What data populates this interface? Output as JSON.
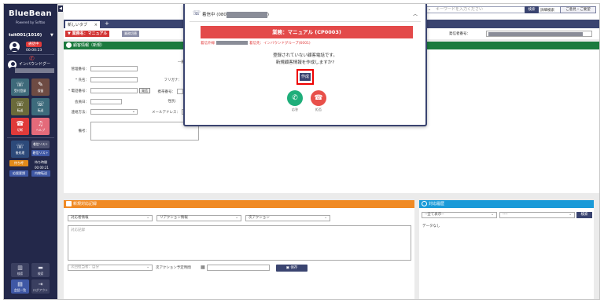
{
  "app": {
    "logo": "BlueBean",
    "logo_sub": "Powered by Softbo"
  },
  "sidebar": {
    "user_id": "tsit001(1010)",
    "status": "通話中",
    "status_time": "00:00:23",
    "group": "インバウンドグー",
    "tiles_row1": [
      {
        "label": "受付登録",
        "icon": "☏"
      },
      {
        "label": "保留",
        "icon": "✎"
      }
    ],
    "tiles_row2": [
      {
        "label": "転送",
        "icon": "☏"
      },
      {
        "label": "転送",
        "icon": "☏"
      }
    ],
    "tiles_row3": [
      {
        "label": "切断",
        "icon": "☎"
      },
      {
        "label": "ヘルプ",
        "icon": "♫"
      }
    ],
    "tiles_row4": [
      {
        "label": "後処理",
        "icon": "☏"
      },
      {
        "label": "着信リスト",
        "icon": "☰"
      }
    ],
    "call_list_btn": "着信リスト",
    "waiting_btn": "待ち呼",
    "waiting_count_label": "待ち時間",
    "waiting_time": "00:00:21",
    "btn_a": "応援要請",
    "btn_b": "内線転送",
    "bottom_tiles": [
      {
        "label": "検索",
        "icon": "▥"
      },
      {
        "label": "検索",
        "icon": "▬"
      }
    ],
    "bottom_tiles2": [
      {
        "label": "会話一覧",
        "icon": "▤"
      },
      {
        "label": "ログアウト",
        "icon": "⇥"
      }
    ]
  },
  "topbar": {
    "search_placeholder": "キーワードを入力ください",
    "search_btn": "検索",
    "detail_search": "詳細検索",
    "manage_label": "ご意見・ご要望"
  },
  "tabs": [
    {
      "label": "新しいタブ"
    }
  ],
  "tab_add": "+",
  "tab_close": "×",
  "workrow": {
    "business_label": "▼ 業務名：マニュアル",
    "business_change": "業務切替",
    "caller_label": "発信者番号："
  },
  "customer": {
    "header": "顧客情報（新規）",
    "fields": {
      "manage_no": "管理番号：",
      "name": "* 氏名：",
      "furigana": "フリガナ：",
      "phone": "* 電話番号：",
      "mobile": "携帯番号：",
      "phone_btn": "発信",
      "join_date": "会員日：",
      "gender_label": "性別：",
      "gender_value": "",
      "contact_method": "連絡方法：",
      "email": "メールアドレス：",
      "note": "備考："
    },
    "extra_label": "―顧"
  },
  "record": {
    "header": "新規対応記録",
    "select_a": "対応者情報",
    "select_b": "リアクション情報",
    "select_c": "次アクション",
    "memo_placeholder": "対応記録",
    "next_responder_placeholder": "次回担当者：自分",
    "next_action_time_label": "次アクション予定時間",
    "save": "保存"
  },
  "history": {
    "header": "対応履歴",
    "filter_a": "--全て表示--",
    "filter_b": "----",
    "search_btn": "検索",
    "empty": "データなし"
  },
  "modal": {
    "incoming_prefix": "着信中 (080",
    "incoming_suffix": ")",
    "business": "業務：マニュアル (CP0003)",
    "caller_prefix": "着信外線",
    "dest_prefix": "着信先：インバウンドグループ(6001)",
    "msg1": "登録されていない顧客電話です。",
    "msg2": "新規顧客情報を作成しますか?",
    "create": "作成",
    "answer": "応答",
    "reject": "拒否"
  },
  "colors": {
    "sidebar": "#23284a",
    "accent_red": "#e34a4a",
    "green_header": "#1b7a3e",
    "orange_header": "#f08a24",
    "blue_header": "#1a9ad8"
  }
}
